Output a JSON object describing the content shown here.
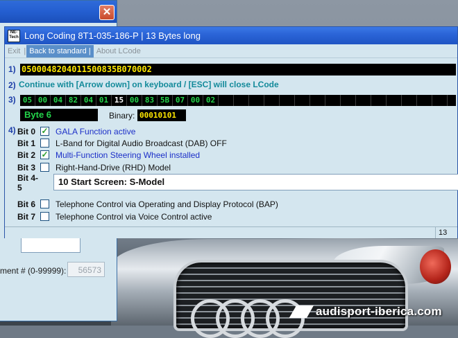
{
  "background_window": {
    "close_glyph": "✕",
    "segment_label": "ment # (0-99999):",
    "segment_value": "56573"
  },
  "window": {
    "app_icon_text": "NE-Tech",
    "title": "Long Coding  8T1-035-186-P  |  13 Bytes long",
    "menu": [
      {
        "label": "Exit",
        "sep": "|"
      },
      {
        "label": "Back to standard",
        "sep": "|",
        "active": true
      },
      {
        "label": "About LCode",
        "sep": ""
      }
    ]
  },
  "steps": {
    "step1": "1)",
    "step2": "2)",
    "step3": "3)",
    "step4": "4)"
  },
  "coding_string": "0500048204011500835B070002",
  "instruction": "Continue with [Arrow down] on keyboard / [ESC] will close LCode",
  "bytes": [
    "05",
    "00",
    "04",
    "82",
    "04",
    "01",
    "15",
    "00",
    "83",
    "5B",
    "07",
    "00",
    "02"
  ],
  "selected_byte_index": 6,
  "byte_label": "Byte 6",
  "binary_label": "Binary:",
  "binary_value": "00010101",
  "bits": [
    {
      "label": "Bit 0",
      "checked": true,
      "text": "GALA Function active"
    },
    {
      "label": "Bit 1",
      "checked": false,
      "text": "L-Band for Digital Audio Broadcast (DAB) OFF"
    },
    {
      "label": "Bit 2",
      "checked": true,
      "text": "Multi-Function Steering Wheel installed"
    },
    {
      "label": "Bit 3",
      "checked": false,
      "text": "Right-Hand-Drive (RHD) Model"
    },
    {
      "label": "Bit 4-5",
      "select_value": "10 Start Screen: S-Model"
    },
    {
      "label": "Bit 6",
      "checked": false,
      "text": "Telephone Control via Operating and Display Protocol (BAP)"
    },
    {
      "label": "Bit 7",
      "checked": false,
      "text": "Telephone Control via Voice Control active"
    }
  ],
  "statusbar": {
    "right_text": "13"
  },
  "watermark": "audisport-iberica.com",
  "colors": {
    "titlebar": "#2a63d6",
    "window_bg": "#d4e6ef",
    "code_text": "#ffe800",
    "byte_text": "#23d34a",
    "checked_text": "#1c2fc8",
    "instruction_text": "#138a9a"
  }
}
